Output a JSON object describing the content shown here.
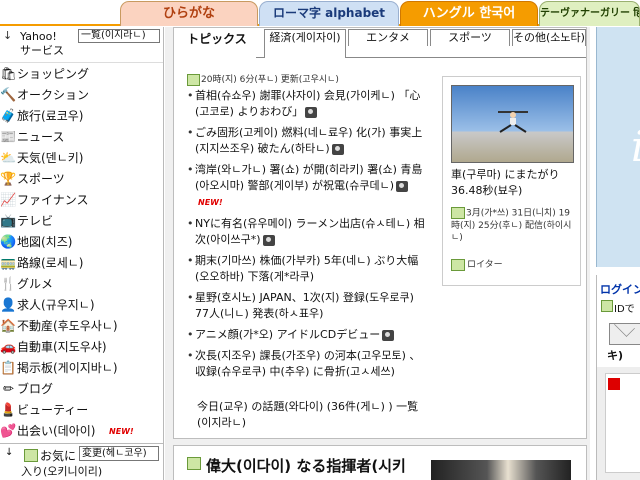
{
  "script_tabs": [
    "ひらがな",
    "ローマ字 alphabet",
    "ハングル 한국어",
    "テーヴァナーガリー हिंदी"
  ],
  "sidebar": {
    "title": "Yahoo!\nサービス",
    "list_button": "一覧(이지라ㄴ)",
    "items": [
      {
        "label": "ショッピング",
        "icon": "shopping-bags-icon",
        "glyph": "🛍"
      },
      {
        "label": "オークション",
        "icon": "auction-gavel-icon",
        "glyph": "🔨"
      },
      {
        "label": "旅行(료코우)",
        "icon": "travel-suitcase-icon",
        "glyph": "🧳"
      },
      {
        "label": "ニュース",
        "icon": "newspaper-icon",
        "glyph": "📰"
      },
      {
        "label": "天気(덴ㄴ키)",
        "icon": "weather-sun-icon",
        "glyph": "⛅"
      },
      {
        "label": "スポーツ",
        "icon": "trophy-icon",
        "glyph": "🏆"
      },
      {
        "label": "ファイナンス",
        "icon": "finance-chart-icon",
        "glyph": "📈"
      },
      {
        "label": "テレビ",
        "icon": "television-icon",
        "glyph": "📺"
      },
      {
        "label": "地図(치즈)",
        "icon": "globe-map-icon",
        "glyph": "🌏"
      },
      {
        "label": "路線(로세ㄴ)",
        "icon": "train-route-icon",
        "glyph": "🚃"
      },
      {
        "label": "グルメ",
        "icon": "gourmet-food-icon",
        "glyph": "🍴"
      },
      {
        "label": "求人(규우지ㄴ)",
        "icon": "job-person-icon",
        "glyph": "👤"
      },
      {
        "label": "不動産(후도우사ㄴ)",
        "icon": "real-estate-house-icon",
        "glyph": "🏠"
      },
      {
        "label": "自動車(지도우샤)",
        "icon": "car-icon",
        "glyph": "🚗"
      },
      {
        "label": "掲示板(게이지바ㄴ)",
        "icon": "bulletin-board-icon",
        "glyph": "📋"
      },
      {
        "label": "ブログ",
        "icon": "blog-pen-icon",
        "glyph": "✏"
      },
      {
        "label": "ビューティー",
        "icon": "beauty-bottle-icon",
        "glyph": "💄"
      },
      {
        "label": "出会い(데아이)",
        "icon": "meeting-heart-icon",
        "glyph": "💕",
        "badge": "NEW!"
      }
    ],
    "favorites": {
      "label1": "お気に",
      "button": "変更(헤ㄴ코우)",
      "label2": "入り(오키니이리)"
    }
  },
  "topics": {
    "tabs": [
      "トピックス",
      "経済(게이자이)",
      "エンタメ",
      "スポーツ",
      "その他(소노타)"
    ],
    "active_tab": "トピックス",
    "updated": "20時(지) 6分(푸ㄴ) 更新(고우시ㄴ)",
    "items": [
      {
        "text": "首相(슈쇼우) 謝罪(샤자이) 会見(가이케ㄴ) 「心(고코로) よりおわび」",
        "photo": true
      },
      {
        "text": "ごみ固形(고케이) 燃料(네ㄴ료우) 化(가) 事実上(지지쓰조우) 破たん(하타ㄴ)",
        "photo": true
      },
      {
        "text": "湾岸(와ㄴ가ㄴ) 署(쇼) が開(히라키) 署(쇼) 青島(아오시마) 警部(게이부) が祝電(슈쿠데ㄴ)",
        "photo": true,
        "badge": "NEW!"
      },
      {
        "text": "NYに有名(유우메이) ラーメン出店(슈ㅅ테ㄴ) 相次(아이쓰구*)",
        "photo": true
      },
      {
        "text": "期末(기마쓰) 株価(가부카) 5年(네ㄴ) ぶり大幅(오오하바) 下落(게*라쿠)",
        "photo": false
      },
      {
        "text": "星野(호시노) JAPAN、1次(지) 登録(도우로쿠) 77人(니ㄴ) 発表(하ㅅ표우)",
        "photo": false
      },
      {
        "text": "アニメ顔(가*오) アイドルCDデビュー",
        "photo": true
      },
      {
        "text": "次長(지조우) 課長(가조우) の河本(고우모토) 、収録(슈우로쿠) 中(추우) に骨折(고ㅅ세쓰)",
        "photo": false
      }
    ],
    "more": "今日(교우) の話題(와다이) (36件(게ㄴ) ) 一覧(이지라ㄴ)"
  },
  "photo_news": {
    "caption": "車(구루마) にまたがり 36.48秒(뵤우)",
    "meta": "3月(가*쓰) 31日(니치) 19時(지) 25分(후ㄴ) 配信(하이시ㄴ)",
    "source": "ロイター"
  },
  "feature": {
    "title": "偉大(이다이) なる指揮者(시키"
  },
  "right": {
    "promo_glyph": "i",
    "login_title": "ログイン",
    "login_sub": "IDで",
    "paren": "キ)"
  }
}
